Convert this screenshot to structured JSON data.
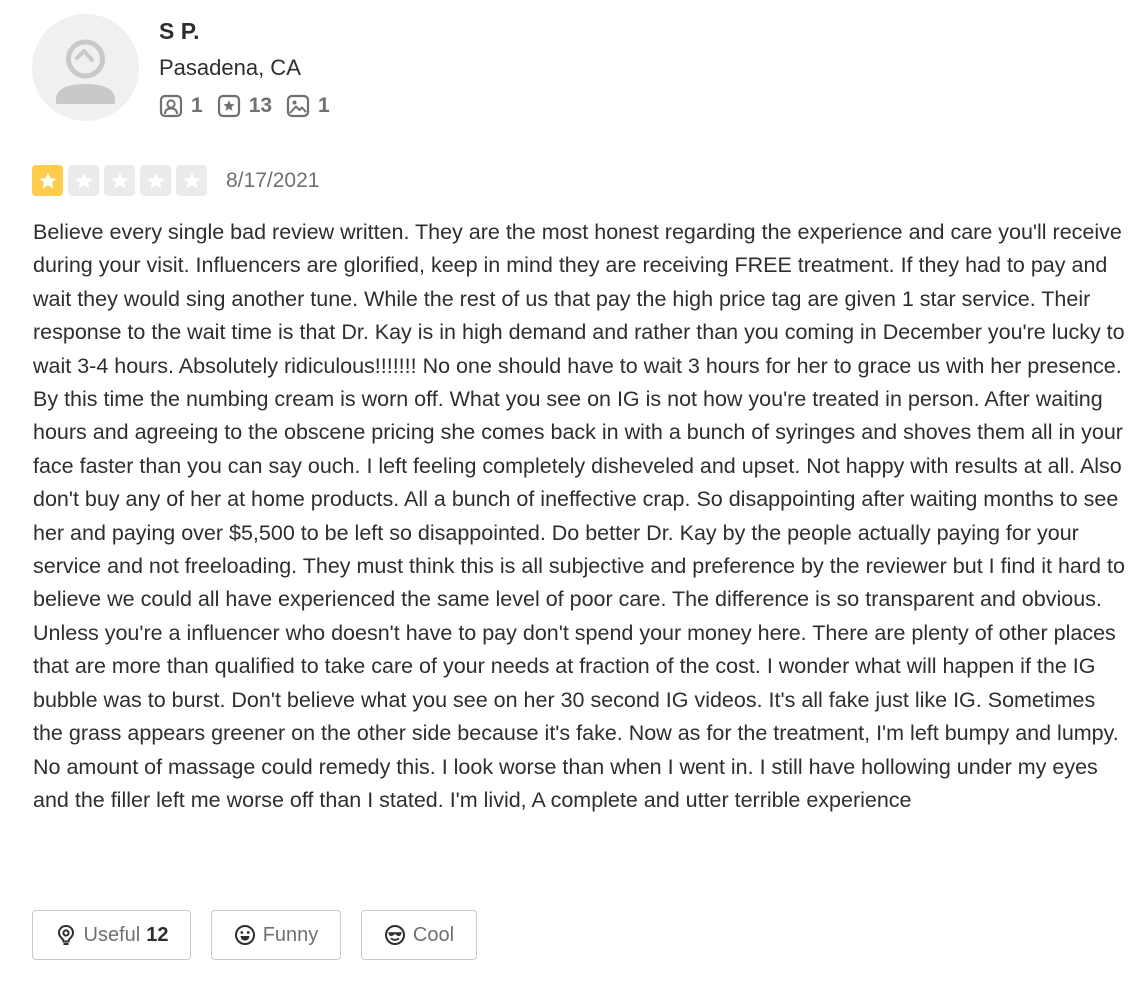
{
  "user": {
    "name": "S P.",
    "location": "Pasadena, CA",
    "stats": [
      {
        "icon": "friends-icon",
        "value": "1"
      },
      {
        "icon": "reviews-star-icon",
        "value": "13"
      },
      {
        "icon": "photos-icon",
        "value": "1"
      }
    ]
  },
  "review": {
    "rating": 1,
    "rating_max": 5,
    "star_color": "#ffcc4b",
    "date": "8/17/2021",
    "text": "Believe every single bad review written. They are the most honest regarding the experience and care you'll receive during your visit. Influencers are glorified, keep in mind they are  receiving FREE treatment. If they had to pay and wait they would sing another tune. While the rest of us that pay the high price tag are given 1 star service. Their response to the wait time is that Dr. Kay is in high demand and rather than you coming in December you're lucky to wait 3-4 hours. Absolutely ridiculous!!!!!!! No one should have to wait 3 hours for her to grace  us with her presence. By this time the numbing cream is worn off. What you see on IG is not how you're treated in person. After waiting hours and agreeing to the obscene pricing she comes back in with a bunch of syringes and shoves them all in your face faster than you can say ouch. I left feeling completely disheveled and upset. Not happy with results at all. Also don't buy any of her at home products. All a bunch of ineffective crap. So disappointing after waiting months to see her and paying over $5,500 to be left so disappointed. Do better Dr. Kay by the people actually paying for your service and not freeloading. They must think this is all subjective and preference by the reviewer but I find it hard to believe we could all have experienced the same level of poor care. The difference is so transparent and obvious. Unless you're a influencer who doesn't have to pay don't spend your money here. There are plenty of other places that are more than qualified to take care of your needs at fraction of the cost. I wonder what will happen if the IG bubble was to burst. Don't believe what you see on her 30 second IG videos. It's all fake just like IG. Sometimes the grass appears greener on the other side because it's fake. Now as for the treatment, I'm left bumpy and lumpy. No amount of massage could remedy this. I look worse than when I went in. I still have hollowing under my eyes and the filler left me worse off than I stated. I'm livid, A complete and utter terrible experience"
  },
  "reactions": {
    "useful": {
      "label": "Useful",
      "count": "12",
      "icon": "lightbulb-icon"
    },
    "funny": {
      "label": "Funny",
      "icon": "funny-face-icon"
    },
    "cool": {
      "label": "Cool",
      "icon": "sunglasses-face-icon"
    }
  }
}
